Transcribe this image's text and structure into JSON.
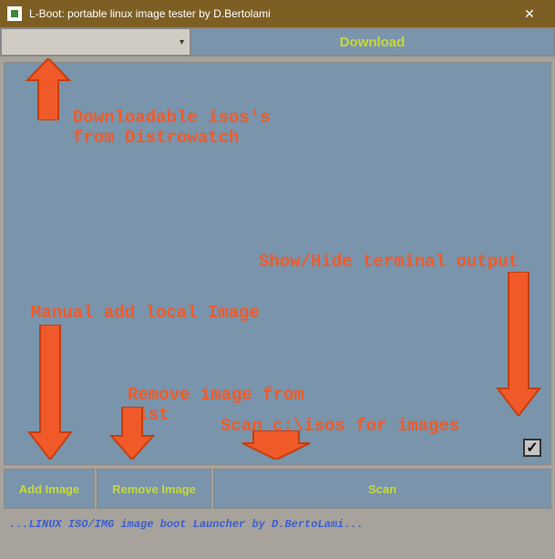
{
  "title": "L-Boot: portable linux image tester by D.Bertolami",
  "top": {
    "download_label": "Download"
  },
  "buttons": {
    "add": "Add Image",
    "remove": "Remove Image",
    "scan": "Scan"
  },
  "status": "...LINUX ISO/IMG image boot Launcher by D.BertoLami...",
  "annotations": {
    "a1": "Downloadable isos's\nfrom Distrowatch",
    "a2": "Show/Hide terminal output",
    "a3": "Manual add local Image",
    "a4": "Remove image from\nlist",
    "a5": "Scan c:\\isos for images"
  },
  "checkbox_checked": "✓"
}
